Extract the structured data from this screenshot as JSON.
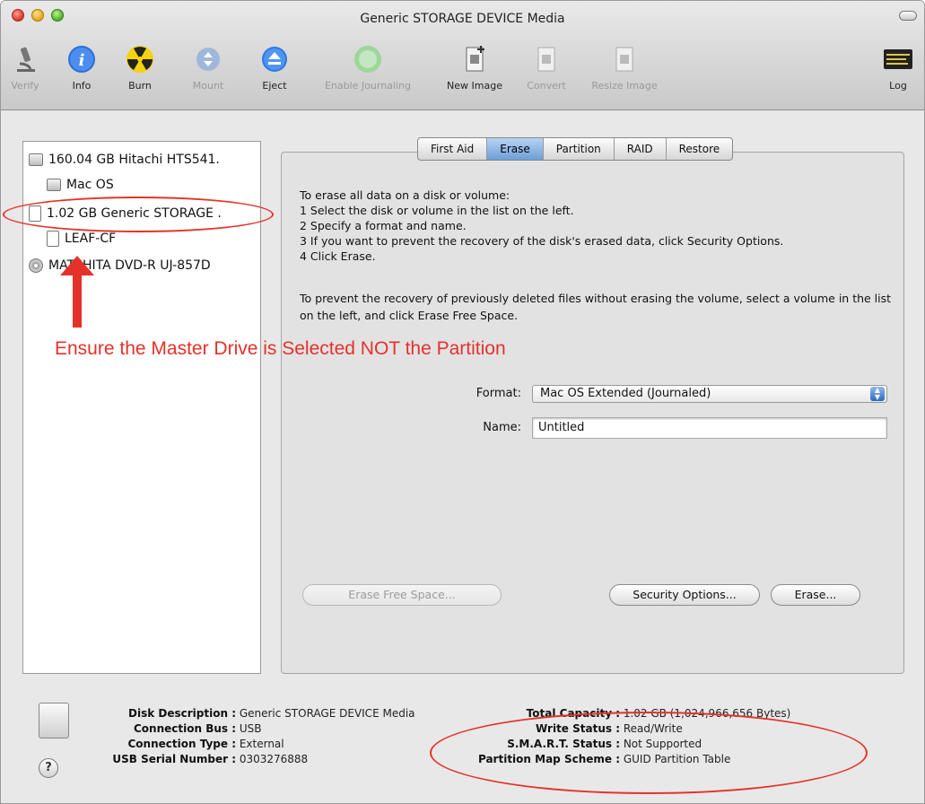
{
  "window": {
    "title": "Generic STORAGE DEVICE Media"
  },
  "toolbar": {
    "items": [
      {
        "label": "Verify",
        "icon": "microscope-icon",
        "enabled": false
      },
      {
        "label": "Info",
        "icon": "info-icon",
        "enabled": true
      },
      {
        "label": "Burn",
        "icon": "burn-icon",
        "enabled": true
      },
      {
        "label": "Mount",
        "icon": "mount-icon",
        "enabled": false
      },
      {
        "label": "Eject",
        "icon": "eject-icon",
        "enabled": true
      },
      {
        "label": "Enable Journaling",
        "icon": "journaling-icon",
        "enabled": false
      },
      {
        "label": "New Image",
        "icon": "new-image-icon",
        "enabled": true
      },
      {
        "label": "Convert",
        "icon": "convert-icon",
        "enabled": false
      },
      {
        "label": "Resize Image",
        "icon": "resize-image-icon",
        "enabled": false
      },
      {
        "label": "Log",
        "icon": "log-icon",
        "enabled": true
      }
    ]
  },
  "sidebar": {
    "items": [
      {
        "label": "160.04 GB Hitachi HTS541.",
        "icon": "hard-drive-icon"
      },
      {
        "label": "Mac OS",
        "icon": "volume-icon"
      },
      {
        "label": "1.02 GB Generic STORAGE .",
        "icon": "external-drive-icon"
      },
      {
        "label": "LEAF-CF",
        "icon": "volume-icon"
      },
      {
        "label": "MATSHITA DVD-R UJ-857D",
        "icon": "optical-drive-icon"
      }
    ]
  },
  "tabs": [
    "First Aid",
    "Erase",
    "Partition",
    "RAID",
    "Restore"
  ],
  "erase": {
    "instructions": [
      "To erase all data on a disk or volume:",
      "1 Select the disk or volume in the list on the left.",
      "2 Specify a format and name.",
      "3 If you want to prevent the recovery of the disk's erased data, click Security Options.",
      "4 Click Erase."
    ],
    "free_space_text": "To prevent the recovery of previously deleted files without erasing the volume, select a volume in the list on the left, and click Erase Free Space.",
    "format_label": "Format:",
    "format_value": "Mac OS Extended (Journaled)",
    "name_label": "Name:",
    "name_value": "Untitled",
    "erase_free_space_button": "Erase Free Space...",
    "security_options_button": "Security Options...",
    "erase_button": "Erase..."
  },
  "annotation": {
    "text": "Ensure the Master Drive is Selected NOT the Partition",
    "color": "#e4322a"
  },
  "info": {
    "left": [
      {
        "key": "Disk Description :",
        "value": "Generic STORAGE DEVICE Media"
      },
      {
        "key": "Connection Bus :",
        "value": "USB"
      },
      {
        "key": "Connection Type :",
        "value": "External"
      },
      {
        "key": "USB Serial Number :",
        "value": "0303276888"
      }
    ],
    "right": [
      {
        "key": "Total Capacity :",
        "value": "1.02 GB (1,024,966,656 Bytes)"
      },
      {
        "key": "Write Status :",
        "value": "Read/Write"
      },
      {
        "key": "S.M.A.R.T. Status :",
        "value": "Not Supported"
      },
      {
        "key": "Partition Map Scheme :",
        "value": "GUID Partition Table"
      }
    ],
    "help": "?"
  },
  "colors": {
    "selected_tab": "#6c9fd8",
    "annotation": "#e4322a"
  }
}
